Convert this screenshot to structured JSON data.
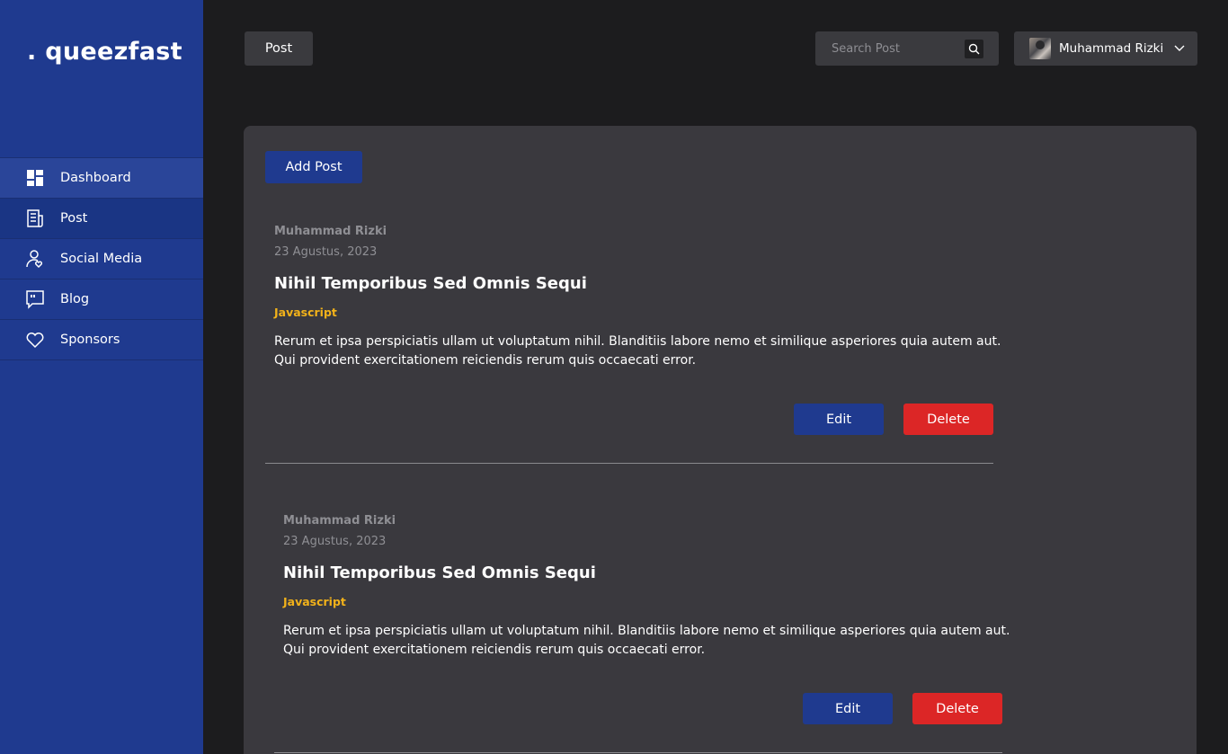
{
  "app": {
    "logo": ". queezfast"
  },
  "sidebar": {
    "items": [
      {
        "label": "Dashboard",
        "icon": "dashboard-icon"
      },
      {
        "label": "Post",
        "icon": "document-icon"
      },
      {
        "label": "Social Media",
        "icon": "user-heart-icon"
      },
      {
        "label": "Blog",
        "icon": "quote-icon"
      },
      {
        "label": "Sponsors",
        "icon": "heart-icon"
      }
    ],
    "active": "Post"
  },
  "header": {
    "page_label": "Post",
    "search": {
      "placeholder": "Search Post",
      "value": "",
      "icon": "search-icon"
    },
    "user": {
      "name": "Muhammad Rizki",
      "icon": "chevron-down-icon"
    }
  },
  "main": {
    "add_post_label": "Add Post",
    "posts": [
      {
        "author": "Muhammad Rizki",
        "date": "23 Agustus, 2023",
        "title": "Nihil Temporibus Sed Omnis Sequi",
        "tag": "Javascript",
        "body": "Rerum et ipsa perspiciatis ullam ut voluptatum nihil. Blanditiis labore nemo et similique asperiores quia autem aut. Qui provident exercitationem reiciendis rerum quis occaecati error.",
        "edit_label": "Edit",
        "delete_label": "Delete"
      },
      {
        "author": "Muhammad Rizki",
        "date": "23 Agustus, 2023",
        "title": "Nihil Temporibus Sed Omnis Sequi",
        "tag": "Javascript",
        "body": "Rerum et ipsa perspiciatis ullam ut voluptatum nihil. Blanditiis labore nemo et similique asperiores quia autem aut. Qui provident exercitationem reiciendis rerum quis occaecati error.",
        "edit_label": "Edit",
        "delete_label": "Delete"
      }
    ]
  },
  "colors": {
    "sidebar": "#1f3a8f",
    "background": "#1c1c1e",
    "panel": "#3a393e",
    "primary_button": "#1f3a8f",
    "danger_button": "#dc2626",
    "tag": "#f2b21a"
  }
}
